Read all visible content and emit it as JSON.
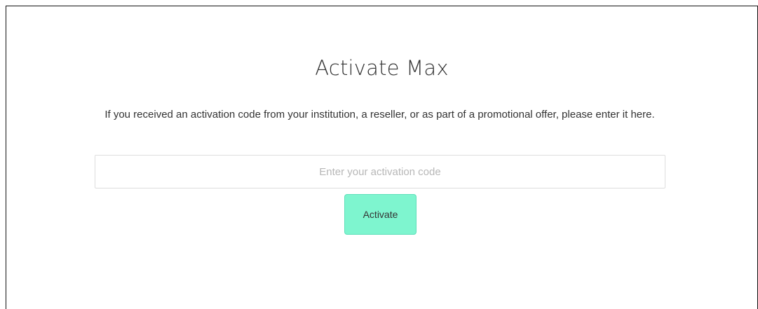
{
  "activation": {
    "title": "Activate Max",
    "description": "If you received an activation code from your institution, a reseller, or as part of a promotional offer, please enter it here.",
    "code_input": {
      "value": "",
      "placeholder": "Enter your activation code"
    },
    "activate_label": "Activate"
  },
  "colors": {
    "button_background": "#7ef5cf",
    "button_border": "#5ee0ba",
    "text": "#333333",
    "placeholder": "#b7b7b7",
    "input_border": "#dddddd"
  }
}
